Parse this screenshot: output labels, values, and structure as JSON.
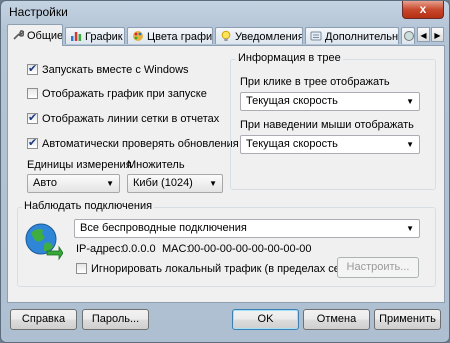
{
  "window": {
    "title": "Настройки",
    "close_label": "x"
  },
  "tabs": [
    {
      "label": "Общие",
      "icon": "wrench-icon",
      "active": true
    },
    {
      "label": "График",
      "icon": "chart-icon"
    },
    {
      "label": "Цвета графика",
      "icon": "palette-icon"
    },
    {
      "label": "Уведомления",
      "icon": "bulb-icon"
    },
    {
      "label": "Дополнительные",
      "icon": "settings-icon"
    }
  ],
  "scroll": {
    "left": "◀",
    "right": "▶"
  },
  "general": {
    "checkboxes": [
      {
        "label": "Запускать вместе с Windows",
        "checked": true
      },
      {
        "label": "Отображать график при запуске",
        "checked": false
      },
      {
        "label": "Отображать линии сетки в отчетах",
        "checked": true
      },
      {
        "label": "Автоматически проверять обновления",
        "checked": true
      }
    ],
    "units_label": "Единицы измерения",
    "units_value": "Авто",
    "multiplier_label": "Множитель",
    "multiplier_value": "Киби (1024)"
  },
  "tray": {
    "title": "Информация в трее",
    "click_label": "При клике в трее отображать",
    "click_value": "Текущая скорость",
    "hover_label": "При наведении мыши отображать",
    "hover_value": "Текущая скорость"
  },
  "connections": {
    "title": "Наблюдать подключения",
    "selected": "Все беспроводные подключения",
    "ip_label": "IP-адрес:",
    "ip_value": "0.0.0.0",
    "mac_label": "MAC:",
    "mac_value": "00-00-00-00-00-00-00-00",
    "ignore_label": "Игнорировать локальный трафик (в пределах сети)",
    "ignore_checked": false,
    "configure_label": "Настроить..."
  },
  "buttons": {
    "help": "Справка",
    "password": "Пароль...",
    "ok": "OK",
    "cancel": "Отмена",
    "apply": "Применить"
  }
}
